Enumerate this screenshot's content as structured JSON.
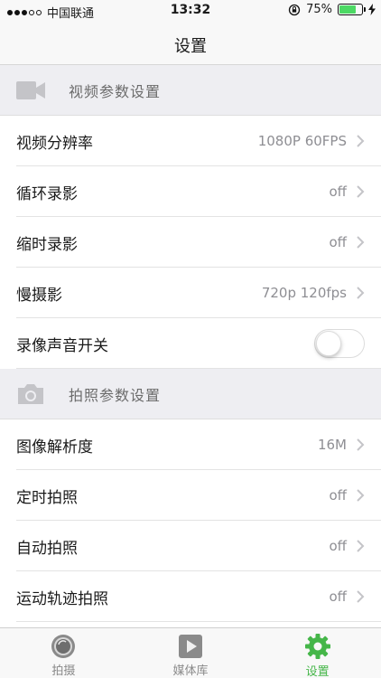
{
  "status_bar": {
    "carrier": "中国联通",
    "time": "13:32",
    "battery": "75%",
    "battery_level": 0.75
  },
  "nav": {
    "title": "设置"
  },
  "video_section": {
    "title": "视频参数设置",
    "icon": "video-camera-icon",
    "rows": [
      {
        "label": "视频分辨率",
        "value": "1080P 60FPS"
      },
      {
        "label": "循环录影",
        "value": "off"
      },
      {
        "label": "缩时录影",
        "value": "off"
      },
      {
        "label": "慢摄影",
        "value": "720p 120fps"
      }
    ],
    "toggle_row": {
      "label": "录像声音开关",
      "on": false
    }
  },
  "photo_section": {
    "title": "拍照参数设置",
    "icon": "photo-camera-icon",
    "rows": [
      {
        "label": "图像解析度",
        "value": "16M"
      },
      {
        "label": "定时拍照",
        "value": "off"
      },
      {
        "label": "自动拍照",
        "value": "off"
      },
      {
        "label": "运动轨迹拍照",
        "value": "off"
      }
    ]
  },
  "tabs": [
    {
      "label": "拍摄",
      "icon": "shutter-icon",
      "active": false
    },
    {
      "label": "媒体库",
      "icon": "media-play-icon",
      "active": false
    },
    {
      "label": "设置",
      "icon": "gear-icon",
      "active": true
    }
  ],
  "colors": {
    "accent": "#45b649",
    "battery": "#4cd964",
    "section_bg": "#eeeef2",
    "secondary_text": "#8e8e93"
  }
}
